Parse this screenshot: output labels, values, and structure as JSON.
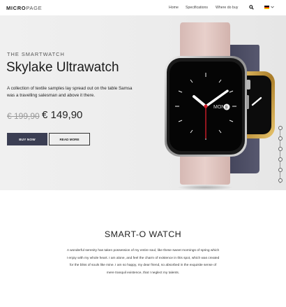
{
  "header": {
    "logo_bold": "MICRO",
    "logo_light": "PAGE",
    "nav": [
      "Home",
      "Specifications",
      "Where do buy"
    ]
  },
  "hero": {
    "eyebrow": "THE SMARTWATCH",
    "title": "Skylake Ultrawatch",
    "description": "A collection of textile samples lay spread out on the table Samsa was a travelling salesman and above it there.",
    "old_price": "€ 199,90",
    "price": "€ 149,90",
    "buy_label": "BUY NOW",
    "read_label": "READ MORE",
    "watch_day": "MON",
    "watch_date": "9"
  },
  "section": {
    "title": "SMART-O WATCH",
    "text": "A wonderful serenity has taken possession of my entire soul, like these sweet mornings of spring which I enjoy with my whole heart. I am alone, and feel the charm of existence in this spot, which was created for the bliss of souls like mine. I am so happy, my dear friend, so absorbed in the exquisite sense of mere tranquil existence, that I neglect my talents."
  },
  "colors": {
    "accent": "#3b3e53",
    "strap_front": "#e2c8c3",
    "strap_back": "#4a4b62"
  },
  "icons": [
    "search-icon",
    "flag-icon",
    "chevron-down-icon"
  ]
}
